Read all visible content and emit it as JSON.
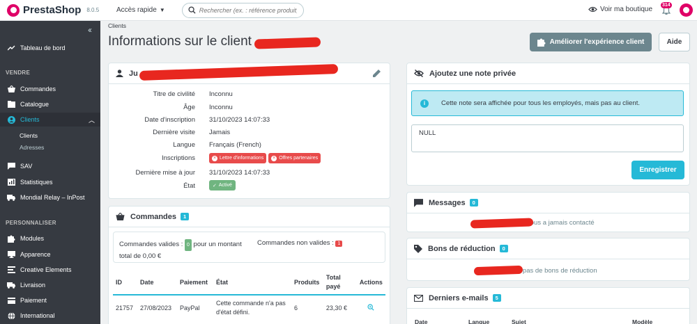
{
  "header": {
    "brand": "PrestaShop",
    "version": "8.0.5",
    "quick_access": "Accès rapide",
    "search_placeholder": "Rechercher (ex. : référence produit, no",
    "view_shop": "Voir ma boutique",
    "notifications_count": "314"
  },
  "sidebar": {
    "dashboard": "Tableau de bord",
    "section_sell": "VENDRE",
    "orders": "Commandes",
    "catalog": "Catalogue",
    "customers": "Clients",
    "customers_sub": "Clients",
    "addresses_sub": "Adresses",
    "sav": "SAV",
    "stats": "Statistiques",
    "mondial": "Mondial Relay – InPost",
    "section_customize": "PERSONNALISER",
    "modules": "Modules",
    "appearance": "Apparence",
    "creative": "Creative Elements",
    "shipping": "Livraison",
    "payment": "Paiement",
    "international": "International"
  },
  "page": {
    "breadcrumb": "Clients",
    "title": "Informations sur le client",
    "improve_button": "Améliorer l'expérience client",
    "help_button": "Aide"
  },
  "customer_card": {
    "name_visible": "Ju",
    "rows": [
      {
        "label": "Titre de civilité",
        "value": "Inconnu"
      },
      {
        "label": "Âge",
        "value": "Inconnu"
      },
      {
        "label": "Date d'inscription",
        "value": "31/10/2023 14:07:33"
      },
      {
        "label": "Dernière visite",
        "value": "Jamais"
      },
      {
        "label": "Langue",
        "value": "Français (French)"
      },
      {
        "label": "Inscriptions",
        "value": ""
      },
      {
        "label": "Dernière mise à jour",
        "value": "31/10/2023 14:07:33"
      },
      {
        "label": "État",
        "value": ""
      }
    ],
    "newsletter_tag": "Lettre d'informations",
    "partner_tag": "Offres partenaires",
    "status_tag": "Activé"
  },
  "orders_card": {
    "title": "Commandes",
    "count": "1",
    "valid_label": "Commandes valides :",
    "valid_count": "0",
    "valid_total": "pour un montant total de 0,00 €",
    "invalid_label": "Commandes non valides :",
    "invalid_count": "1",
    "columns": [
      "ID",
      "Date",
      "Paiement",
      "État",
      "Produits",
      "Total payé",
      "Actions"
    ],
    "rows": [
      {
        "id": "21757",
        "date": "27/08/2023",
        "payment": "PayPal",
        "state": "Cette commande n'a pas d'état défini.",
        "products": "6",
        "total": "23,30 €"
      }
    ]
  },
  "note_card": {
    "title": "Ajoutez une note privée",
    "info": "Cette note sera affichée pour tous les employés, mais pas au client.",
    "value": "NULL",
    "save": "Enregistrer"
  },
  "messages_card": {
    "title": "Messages",
    "count": "0",
    "empty": "vous a jamais contacté"
  },
  "vouchers_card": {
    "title": "Bons de réduction",
    "count": "0",
    "empty": "a pas de bons de réduction"
  },
  "emails_card": {
    "title": "Derniers e-mails",
    "count": "5",
    "columns": [
      "Date",
      "Langue",
      "Sujet",
      "Modèle"
    ]
  },
  "colors": {
    "accent": "#25b9d7",
    "sidebar": "#363a41",
    "danger": "#e84b4b",
    "success": "#70b580",
    "brand": "#df0067"
  }
}
